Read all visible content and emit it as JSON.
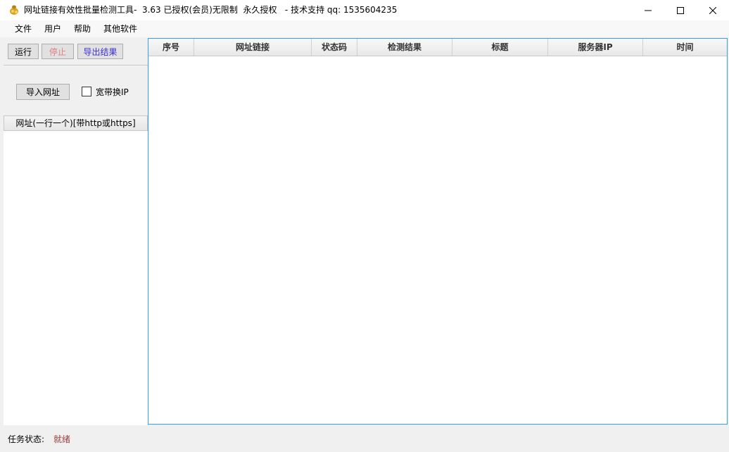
{
  "window": {
    "title": "网址链接有效性批量检测工具-  3.63 已授权(会员)无限制  永久授权   - 技术支持 qq: 1535604235",
    "icon": "coin-bag-icon"
  },
  "menu": {
    "items": [
      "文件",
      "用户",
      "帮助",
      "其他软件"
    ]
  },
  "toolbar": {
    "run_label": "运行",
    "stop_label": "停止",
    "export_label": "导出结果",
    "stop_color": "#e08080",
    "export_color": "#3a2fd0"
  },
  "import": {
    "import_label": "导入网址",
    "broadband_label": "宽带换IP",
    "broadband_checked": false
  },
  "url_list": {
    "header": "网址(一行一个)[带http或https]"
  },
  "grid": {
    "columns": [
      "序号",
      "网址链接",
      "状态码",
      "检测结果",
      "标题",
      "服务器IP",
      "时间"
    ],
    "rows": []
  },
  "status": {
    "label": "任务状态:",
    "value": "就绪",
    "value_color": "#9a3b3b"
  },
  "colors": {
    "accent_border": "#3c9ee6"
  }
}
